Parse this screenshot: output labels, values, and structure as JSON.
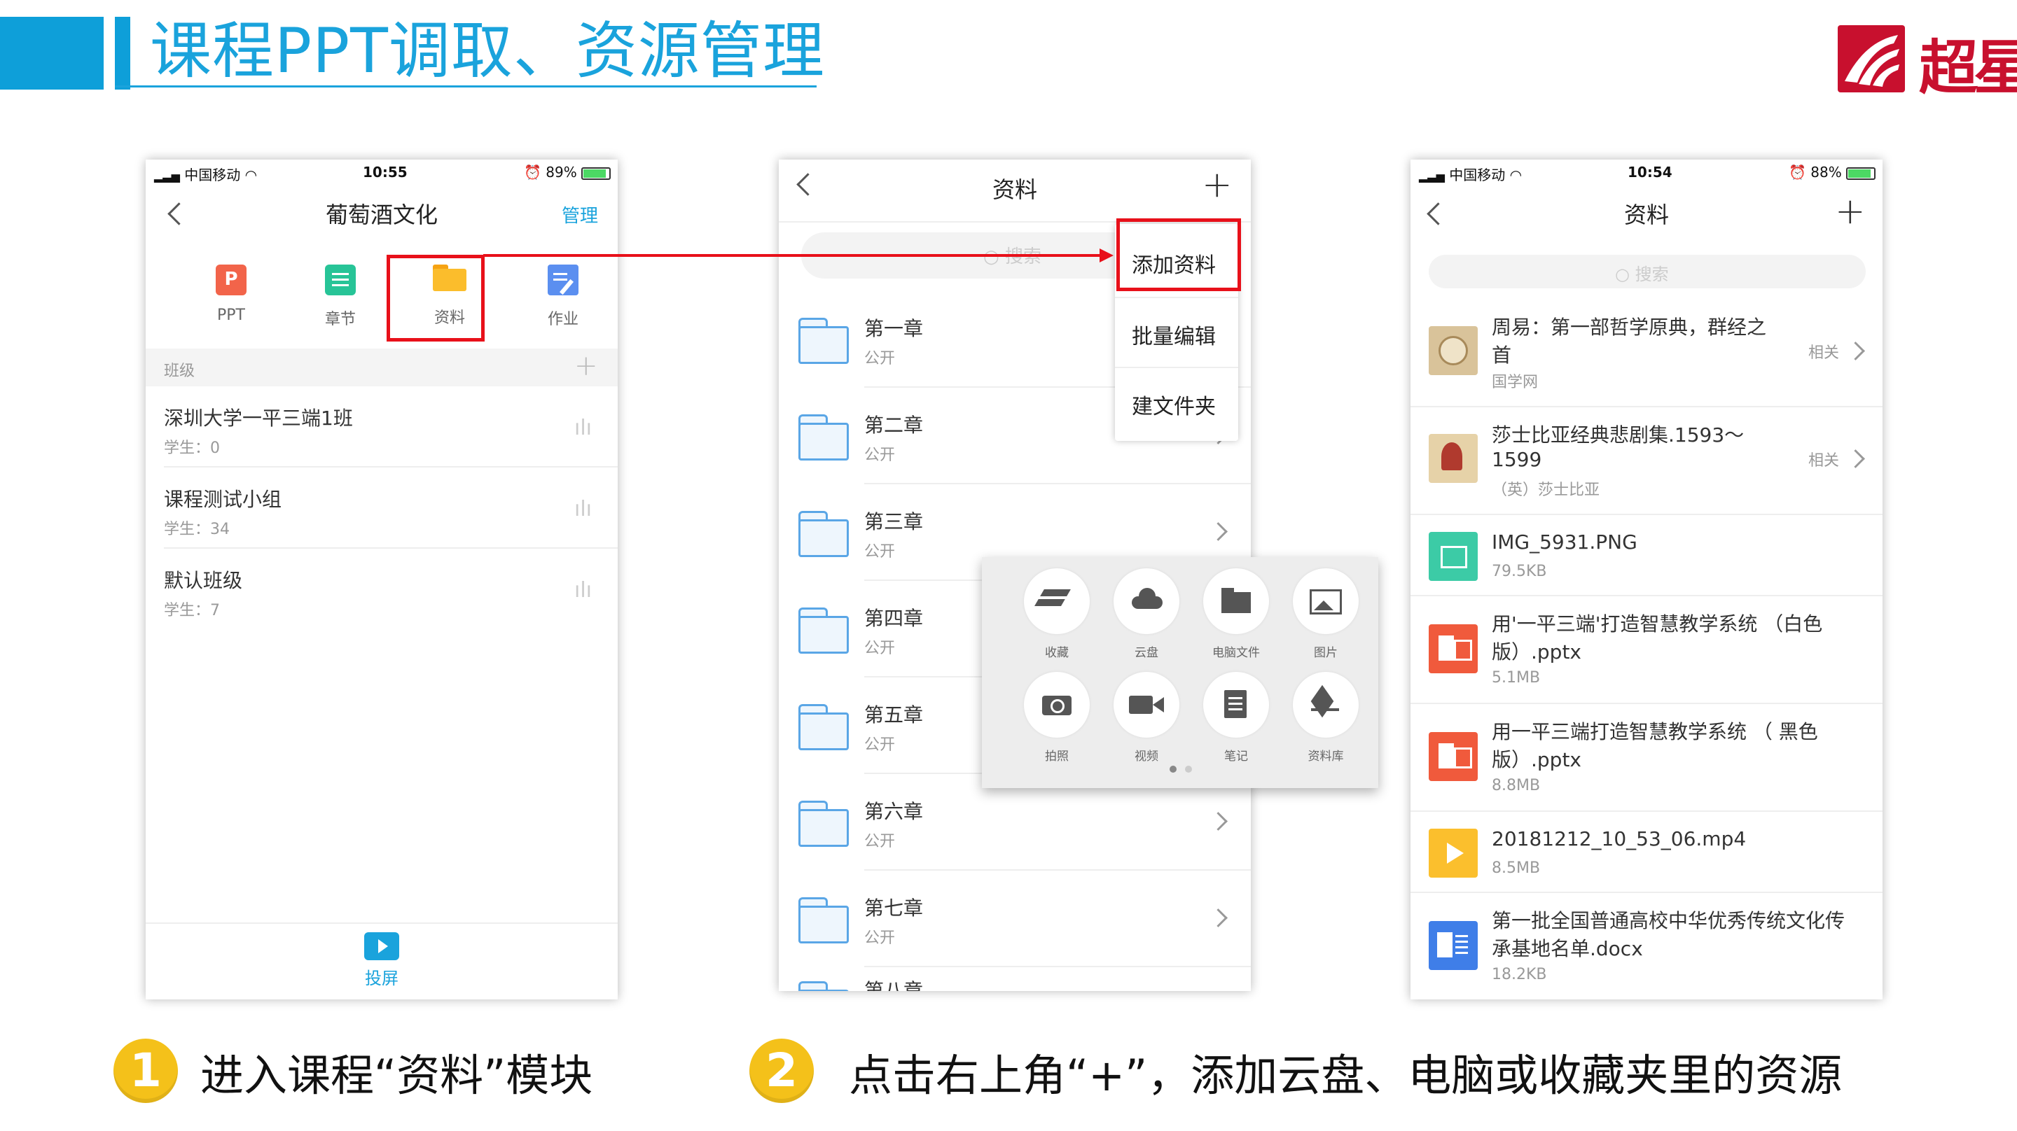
{
  "header": {
    "title": "课程PPT调取、资源管理",
    "logo_text": "超星"
  },
  "phone1": {
    "status": {
      "carrier": "中国移动",
      "time": "10:55",
      "battery": "89%"
    },
    "nav": {
      "title": "葡萄酒文化",
      "manage": "管理"
    },
    "modules": [
      {
        "label": "PPT",
        "icon": "ppt-icon"
      },
      {
        "label": "章节",
        "icon": "chapter-icon"
      },
      {
        "label": "资料",
        "icon": "folder-icon"
      },
      {
        "label": "作业",
        "icon": "homework-icon"
      }
    ],
    "section_label": "班级",
    "classes": [
      {
        "name": "深圳大学一平三端1班",
        "students": "学生：0"
      },
      {
        "name": "课程测试小组",
        "students": "学生：34"
      },
      {
        "name": "默认班级",
        "students": "学生：7"
      }
    ],
    "bottom_label": "投屏"
  },
  "phone2": {
    "nav": {
      "title": "资料"
    },
    "search_placeholder": "搜索",
    "dropdown": [
      "添加资料",
      "批量编辑",
      "建文件夹"
    ],
    "folders": [
      {
        "name": "第一章",
        "status": "公开"
      },
      {
        "name": "第二章",
        "status": "公开"
      },
      {
        "name": "第三章",
        "status": "公开"
      },
      {
        "name": "第四章",
        "status": "公开"
      },
      {
        "name": "第五章",
        "status": "公开"
      },
      {
        "name": "第六章",
        "status": "公开"
      },
      {
        "name": "第七章",
        "status": "公开"
      },
      {
        "name": "第八章",
        "status": ""
      }
    ],
    "popup": [
      {
        "label": "收藏",
        "icon": "favorite-icon"
      },
      {
        "label": "云盘",
        "icon": "cloud-icon"
      },
      {
        "label": "电脑文件",
        "icon": "computer-folder-icon"
      },
      {
        "label": "图片",
        "icon": "image-icon"
      },
      {
        "label": "拍照",
        "icon": "camera-icon"
      },
      {
        "label": "视频",
        "icon": "video-icon"
      },
      {
        "label": "笔记",
        "icon": "note-icon"
      },
      {
        "label": "资料库",
        "icon": "library-icon"
      }
    ]
  },
  "phone3": {
    "status": {
      "carrier": "中国移动",
      "time": "10:54",
      "battery": "88%"
    },
    "nav": {
      "title": "资料"
    },
    "search_placeholder": "搜索",
    "related_label": "相关",
    "files": [
      {
        "title1": "周易：第一部哲学原典，群经之",
        "title2": "首",
        "sub": "国学网",
        "type": "book"
      },
      {
        "title1": "莎士比亚经典悲剧集.1593～",
        "title2": "1599",
        "sub": "（英）莎士比亚",
        "type": "book"
      },
      {
        "title1": "IMG_5931.PNG",
        "title2": "",
        "sub": "79.5KB",
        "type": "image"
      },
      {
        "title1": "用'一平三端'打造智慧教学系统 （白色",
        "title2": "版）.pptx",
        "sub": "5.1MB",
        "type": "ppt"
      },
      {
        "title1": "用一平三端打造智慧教学系统 （ 黑色",
        "title2": "版）.pptx",
        "sub": "8.8MB",
        "type": "ppt"
      },
      {
        "title1": "20181212_10_53_06.mp4",
        "title2": "",
        "sub": "8.5MB",
        "type": "video"
      },
      {
        "title1": "第一批全国普通高校中华优秀传统文化传",
        "title2": "承基地名单.docx",
        "sub": "18.2KB",
        "type": "word"
      }
    ]
  },
  "callouts": [
    {
      "number": "1",
      "text": "进入课程“资料”模块"
    },
    {
      "number": "2",
      "text": "点击右上角“+”，添加云盘、电脑或收藏夹里的资源"
    }
  ],
  "colors": {
    "accent": "#1aa3dc",
    "highlight": "#e8101a",
    "callout_circle": "#f4c11a",
    "logo": "#c8102e"
  }
}
